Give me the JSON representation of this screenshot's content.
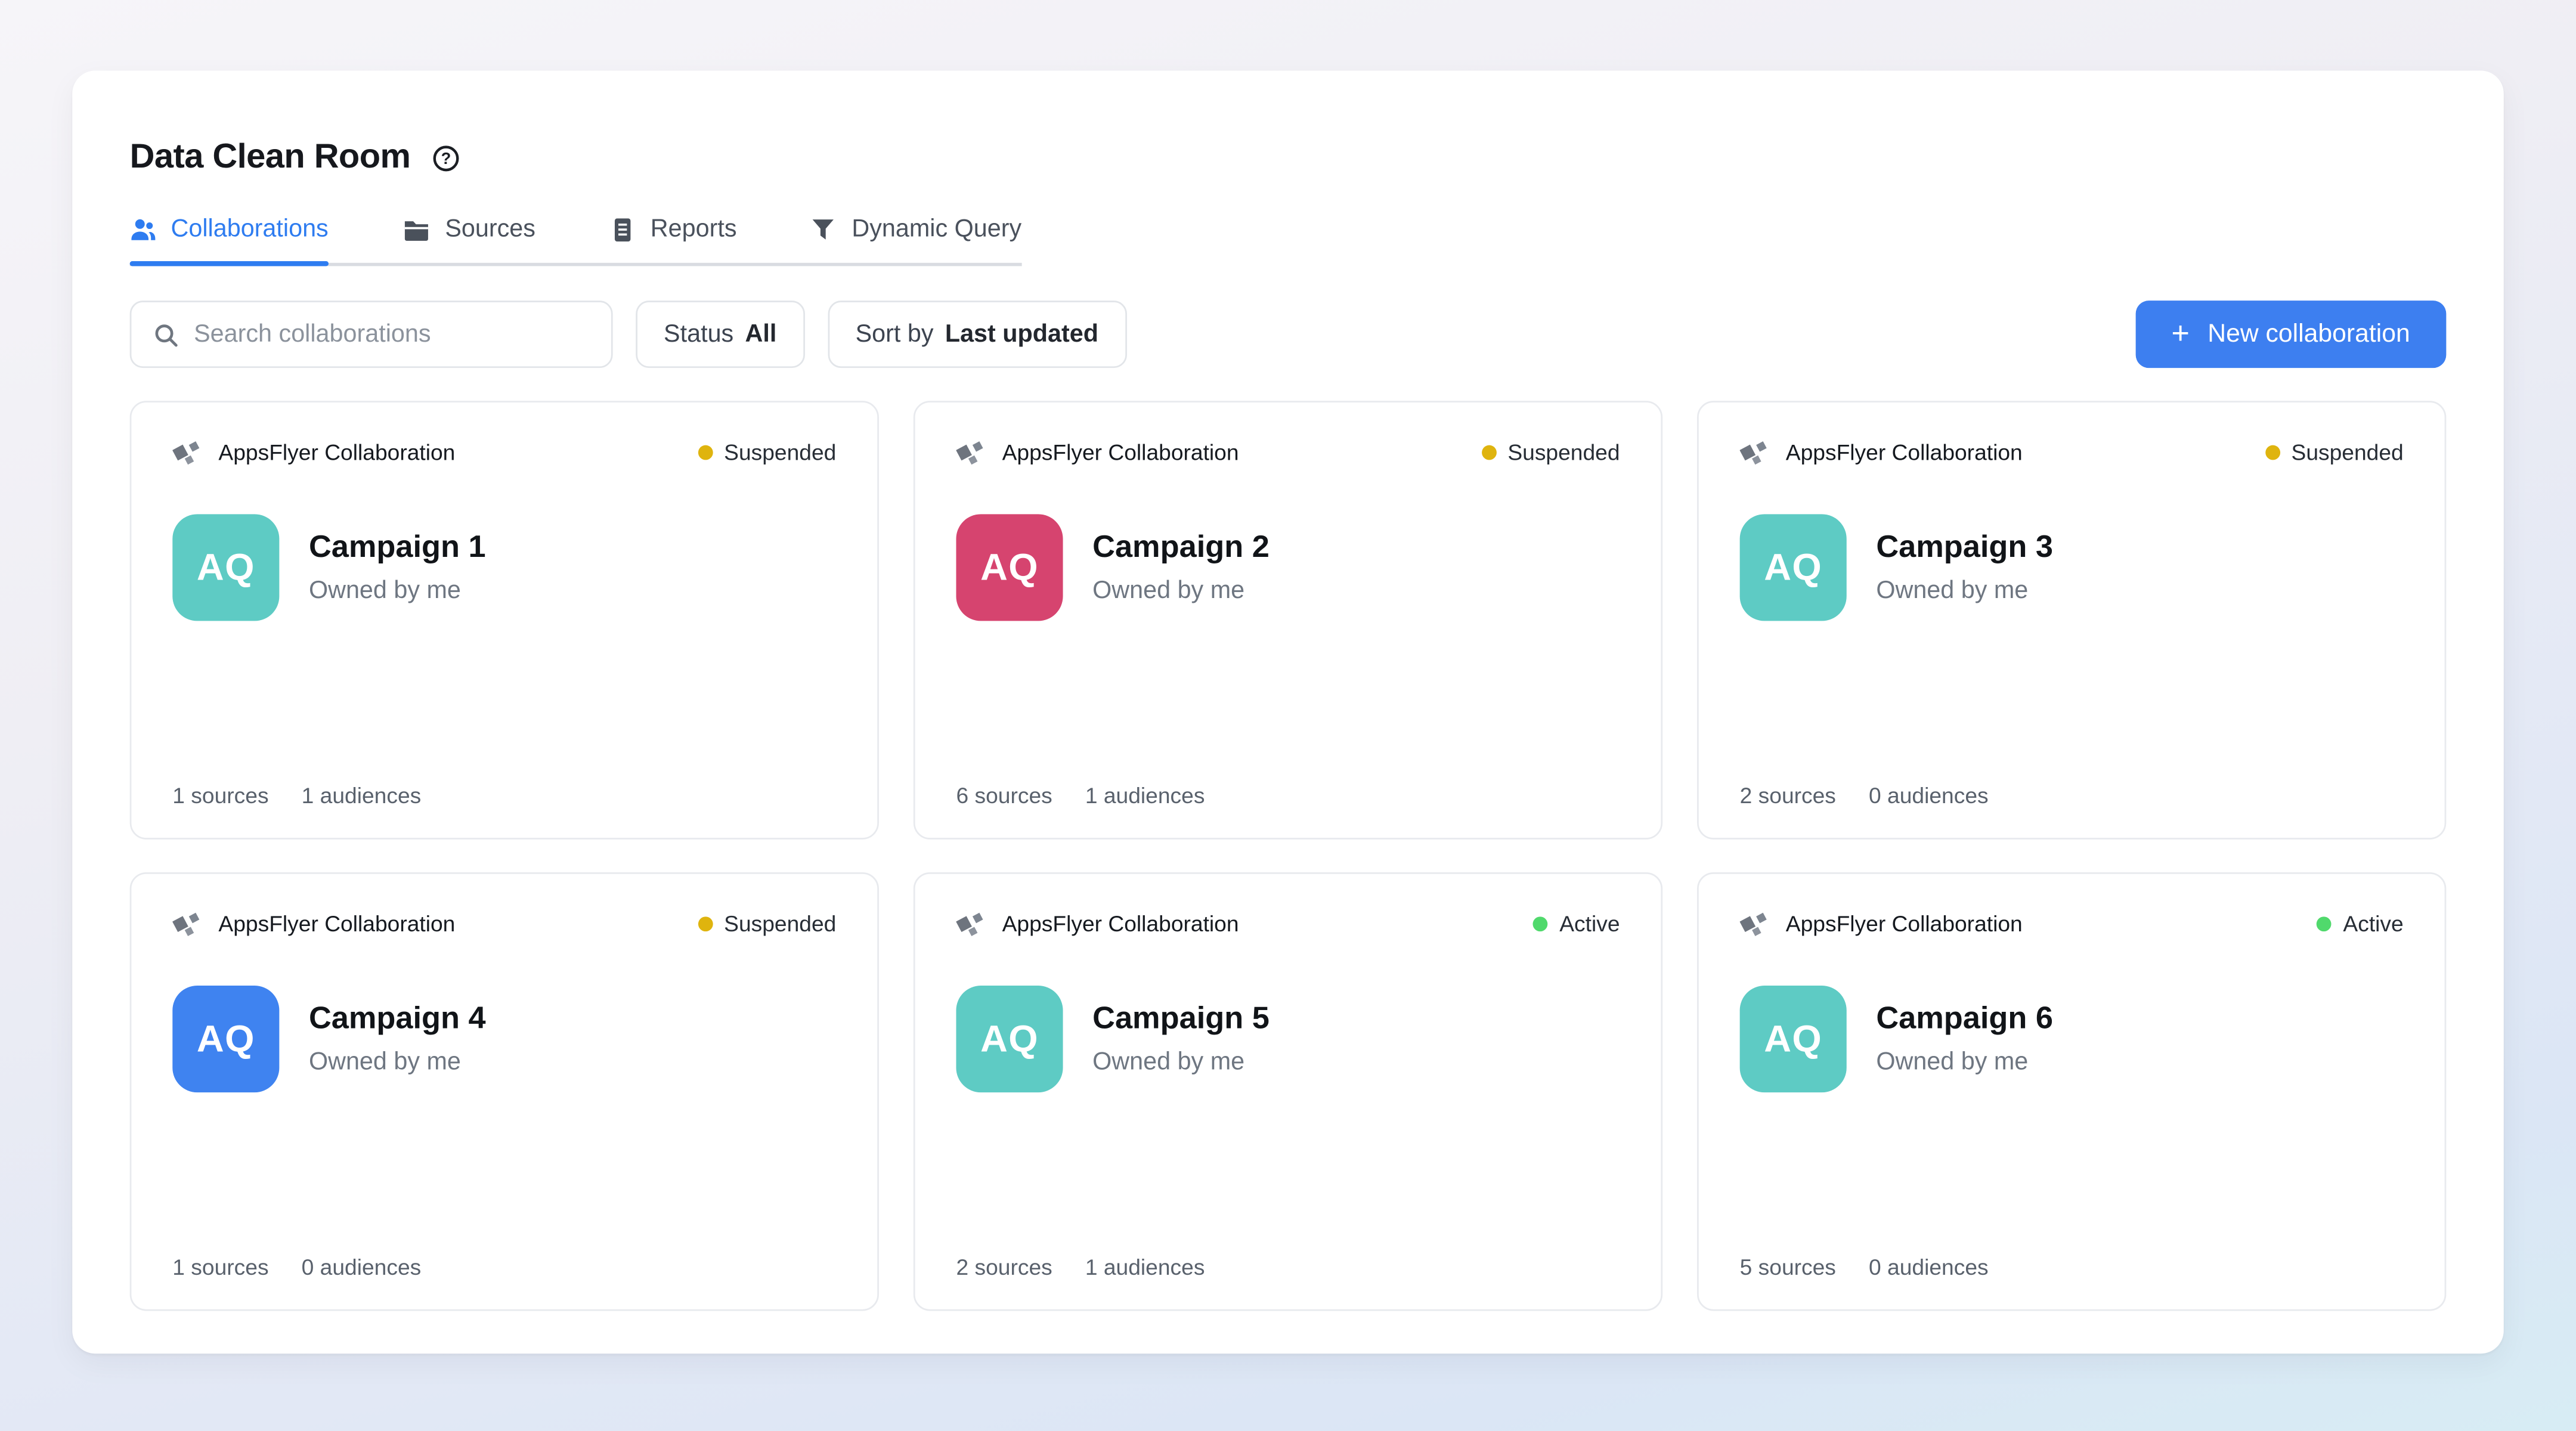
{
  "page": {
    "title": "Data Clean Room"
  },
  "tabs": [
    {
      "label": "Collaborations",
      "icon": "users-icon",
      "active": true
    },
    {
      "label": "Sources",
      "icon": "folder-icon",
      "active": false
    },
    {
      "label": "Reports",
      "icon": "report-icon",
      "active": false
    },
    {
      "label": "Dynamic Query",
      "icon": "funnel-icon",
      "active": false
    }
  ],
  "toolbar": {
    "search_placeholder": "Search collaborations",
    "status_label": "Status",
    "status_value": "All",
    "sort_label": "Sort by",
    "sort_value": "Last updated",
    "new_button_plus": "+",
    "new_button_label": "New collaboration"
  },
  "colors": {
    "accent_blue": "#3d7ff0",
    "tab_active_blue": "#2e7cf0",
    "suspended_amber": "#dfb40e",
    "active_green": "#50d96c",
    "avatar_teal": "#5ecbc4",
    "avatar_pink": "#d6446f",
    "avatar_blue": "#3f83f0"
  },
  "cards": [
    {
      "provider": "AppsFlyer Collaboration",
      "status": "Suspended",
      "status_color": "#dfb40e",
      "avatar_text": "AQ",
      "avatar_color": "#5ecbc4",
      "title": "Campaign 1",
      "owner": "Owned by me",
      "sources": "1 sources",
      "audiences": "1 audiences"
    },
    {
      "provider": "AppsFlyer Collaboration",
      "status": "Suspended",
      "status_color": "#dfb40e",
      "avatar_text": "AQ",
      "avatar_color": "#d6446f",
      "title": "Campaign 2",
      "owner": "Owned by me",
      "sources": "6 sources",
      "audiences": "1 audiences"
    },
    {
      "provider": "AppsFlyer Collaboration",
      "status": "Suspended",
      "status_color": "#dfb40e",
      "avatar_text": "AQ",
      "avatar_color": "#5ecbc4",
      "title": "Campaign 3",
      "owner": "Owned by me",
      "sources": "2 sources",
      "audiences": "0 audiences"
    },
    {
      "provider": "AppsFlyer Collaboration",
      "status": "Suspended",
      "status_color": "#dfb40e",
      "avatar_text": "AQ",
      "avatar_color": "#3f83f0",
      "title": "Campaign 4",
      "owner": "Owned by me",
      "sources": "1 sources",
      "audiences": "0 audiences"
    },
    {
      "provider": "AppsFlyer Collaboration",
      "status": "Active",
      "status_color": "#50d96c",
      "avatar_text": "AQ",
      "avatar_color": "#5ecbc4",
      "title": "Campaign 5",
      "owner": "Owned by me",
      "sources": "2 sources",
      "audiences": "1 audiences"
    },
    {
      "provider": "AppsFlyer Collaboration",
      "status": "Active",
      "status_color": "#50d96c",
      "avatar_text": "AQ",
      "avatar_color": "#5ecbc4",
      "title": "Campaign 6",
      "owner": "Owned by me",
      "sources": "5 sources",
      "audiences": "0 audiences"
    }
  ]
}
